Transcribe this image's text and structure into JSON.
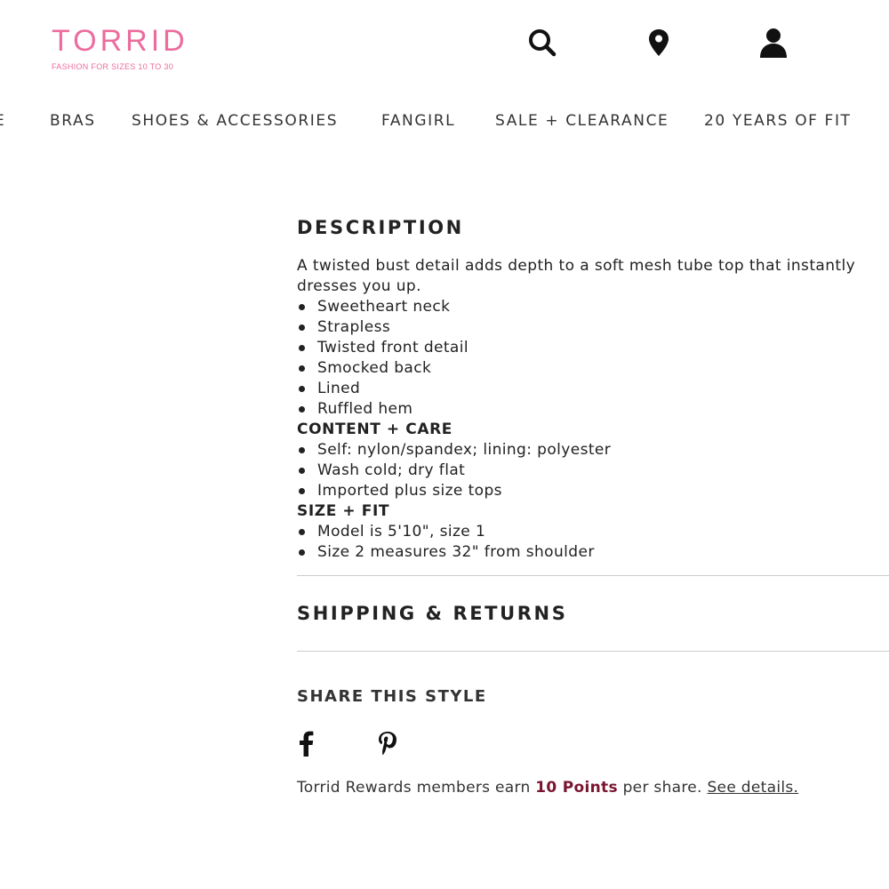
{
  "header": {
    "logo_text": "TORRID",
    "logo_tagline": "FASHION FOR SIZES 10 TO 30",
    "brand_color": "#ec6c9d",
    "icons": [
      "search-icon",
      "location-pin-icon",
      "account-icon"
    ]
  },
  "nav": {
    "items": [
      {
        "label": "E"
      },
      {
        "label": "BRAS"
      },
      {
        "label": "SHOES & ACCESSORIES"
      },
      {
        "label": "FANGIRL"
      },
      {
        "label": "SALE + CLEARANCE"
      },
      {
        "label": "20 YEARS OF FIT"
      }
    ]
  },
  "description": {
    "title": "DESCRIPTION",
    "intro": "A twisted bust detail adds depth to a soft mesh tube top that instantly dresses you up.",
    "features": [
      "Sweetheart neck",
      "Strapless",
      "Twisted front detail",
      "Smocked back",
      "Lined",
      "Ruffled hem"
    ],
    "content_care_heading": "CONTENT + CARE",
    "content_care": [
      "Self: nylon/spandex; lining: polyester",
      "Wash cold; dry flat",
      "Imported plus size tops"
    ],
    "size_fit_heading": "SIZE + FIT",
    "size_fit": [
      "Model is 5'10\", size 1",
      "Size 2 measures 32\" from shoulder"
    ]
  },
  "shipping": {
    "title": "SHIPPING & RETURNS"
  },
  "share": {
    "title": "SHARE THIS STYLE",
    "icons": [
      "facebook-icon",
      "pinterest-icon"
    ],
    "rewards_prefix": "Torrid Rewards members earn ",
    "rewards_points": "10 Points",
    "rewards_suffix": " per share. ",
    "see_details": "See details.",
    "points_color": "#7a1530"
  }
}
